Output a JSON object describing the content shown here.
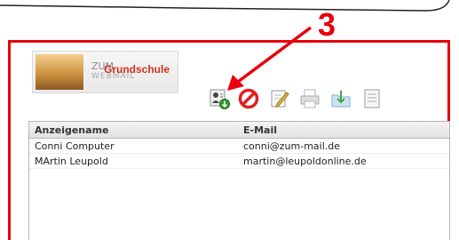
{
  "annotation": {
    "step_number": "3",
    "color": "#e8000b"
  },
  "logo": {
    "line1": "ZUM",
    "line2": "WEBMAIL",
    "school": "Grundschule"
  },
  "toolbar": {
    "icons": [
      "add-contact-icon",
      "delete-icon",
      "edit-icon",
      "print-icon",
      "import-icon",
      "export-icon"
    ]
  },
  "contacts": {
    "columns": [
      "Anzeigename",
      "E-Mail"
    ],
    "rows": [
      {
        "name": "Conni Computer",
        "email": "conni@zum-mail.de"
      },
      {
        "name": "MArtin Leupold",
        "email": "martin@leupoldonline.de"
      }
    ]
  }
}
